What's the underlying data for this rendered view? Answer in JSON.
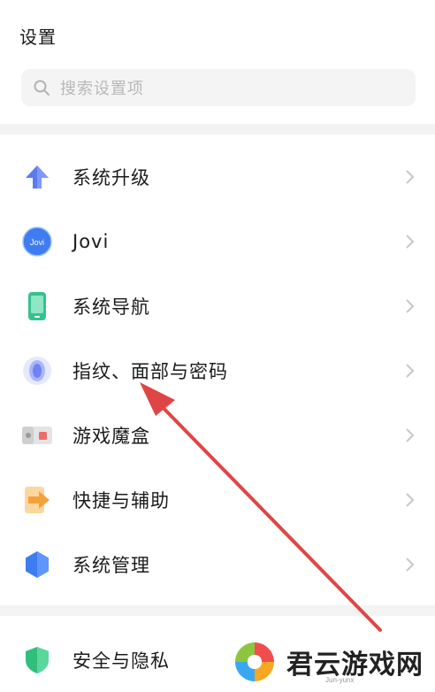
{
  "header": {
    "title": "设置"
  },
  "search": {
    "placeholder": "搜索设置项"
  },
  "menu": [
    {
      "label": "系统升级",
      "icon": "upgrade-arrow-icon"
    },
    {
      "label": "Jovi",
      "icon": "jovi-icon",
      "icon_text": "Jovi"
    },
    {
      "label": "系统导航",
      "icon": "phone-navigation-icon"
    },
    {
      "label": "指纹、面部与密码",
      "icon": "fingerprint-icon"
    },
    {
      "label": "游戏魔盒",
      "icon": "game-box-icon"
    },
    {
      "label": "快捷与辅助",
      "icon": "shortcut-arrow-icon"
    },
    {
      "label": "系统管理",
      "icon": "hexagon-manage-icon"
    },
    {
      "label": "安全与隐私",
      "icon": "shield-icon"
    }
  ],
  "watermark": {
    "text": "君云游戏网",
    "sub": "Jun-yunx"
  },
  "colors": {
    "annotation_arrow": "#e04545",
    "upgrade": "#5b7bf0",
    "jovi": "#3f7cf0",
    "navigation": "#34c38f",
    "fingerprint": "#6f83f5",
    "shortcut": "#f5a13a",
    "manage": "#3d7cf2",
    "security": "#2fbf7a"
  }
}
